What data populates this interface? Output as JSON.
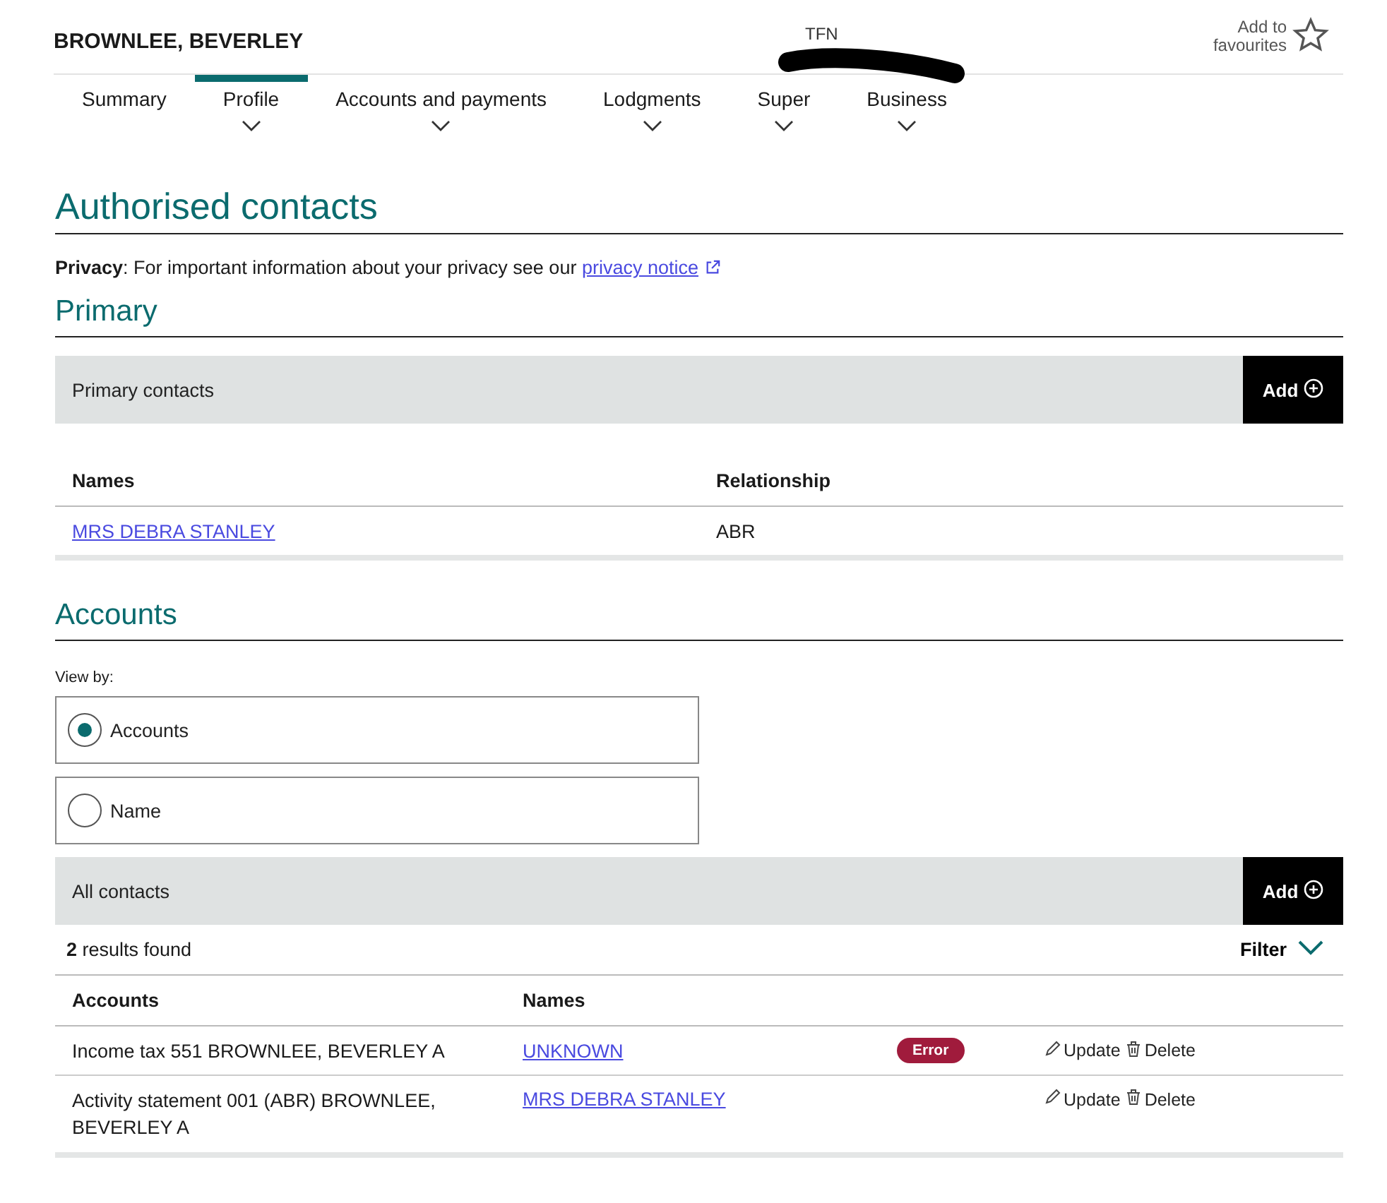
{
  "header": {
    "client_name": "BROWNLEE, BEVERLEY",
    "tfn_label": "TFN",
    "favourite": {
      "label": "Add to favourites",
      "on": false
    }
  },
  "nav": [
    {
      "label": "Summary",
      "selected": false,
      "has_menu": false
    },
    {
      "label": "Profile",
      "selected": true,
      "has_menu": true
    },
    {
      "label": "Accounts and payments",
      "selected": false,
      "has_menu": true
    },
    {
      "label": "Lodgments",
      "selected": false,
      "has_menu": true
    },
    {
      "label": "Super",
      "selected": false,
      "has_menu": true
    },
    {
      "label": "Business",
      "selected": false,
      "has_menu": true
    }
  ],
  "page_title": "Authorised contacts",
  "privacy": {
    "text": "**Privacy**: For important information about your privacy see our",
    "link": "privacy notice"
  },
  "primary": {
    "heading": "Primary",
    "bar_title": "Primary contacts",
    "add_button": "Add",
    "columns": [
      "Names",
      "Relationship"
    ],
    "rows": [
      {
        "name": "MRS DEBRA STANLEY",
        "relationship": "ABR"
      }
    ]
  },
  "accounts": {
    "heading": "Accounts",
    "view_by_label": "View by:",
    "options": [
      {
        "label": "Accounts",
        "selected": true
      },
      {
        "label": "Name",
        "selected": false
      }
    ],
    "bar_title": "All contacts",
    "add_button": "Add",
    "results": "**2** results found",
    "filter": "Filter",
    "columns": [
      "Accounts",
      "Names"
    ],
    "rows": [
      {
        "account": "Income tax 551 BROWNLEE, BEVERLEY A",
        "name": "UNKNOWN",
        "status": "Error",
        "update": "Update",
        "delete": "Delete"
      },
      {
        "account": "Activity statement 001 (ABR) BROWNLEE, BEVERLEY A",
        "name": "MRS DEBRA STANLEY",
        "update": "Update",
        "delete": "Delete"
      }
    ]
  }
}
